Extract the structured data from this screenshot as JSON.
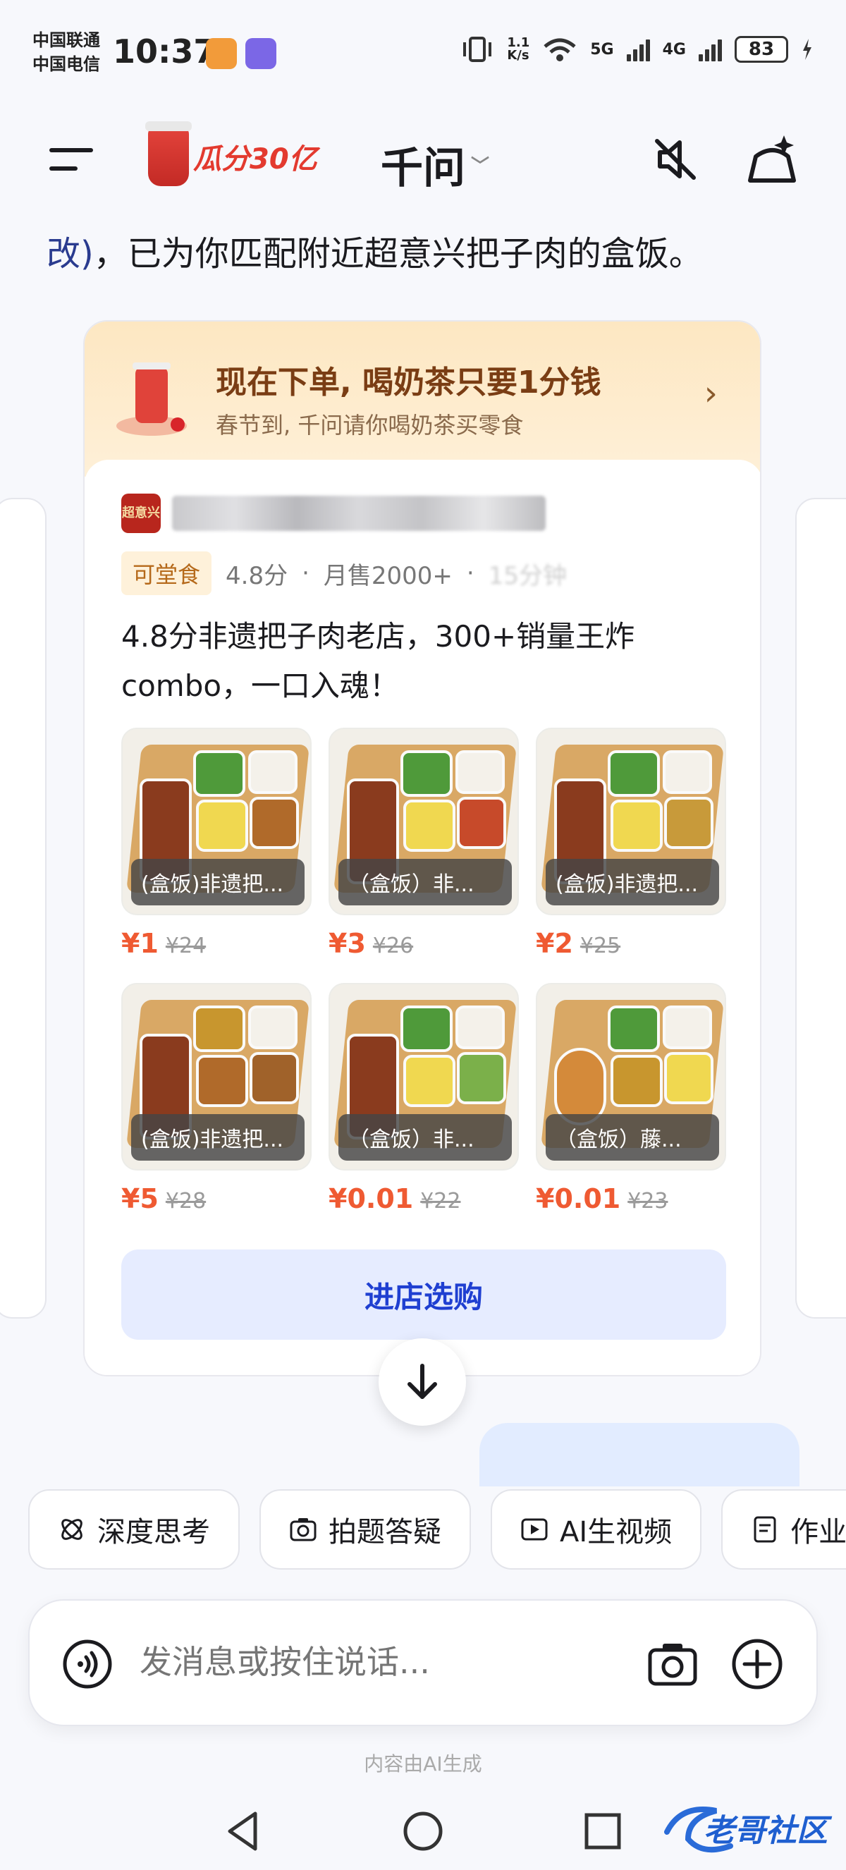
{
  "status_bar": {
    "carrier_1": "中国联通",
    "carrier_2": "中国电信",
    "time": "10:37",
    "speed": "1.1\nK/s",
    "net_1": "5G",
    "net_2": "4G",
    "battery": "83"
  },
  "header": {
    "promo_text": "瓜分30亿",
    "title": "千问",
    "menu_icon": "menu-icon",
    "mute_icon": "speaker-muted-icon",
    "new_chat_icon": "sparkle-compose-icon"
  },
  "intro": {
    "accent": "改)",
    "text": "，已为你匹配附近超意兴把子肉的盒饭。"
  },
  "banner": {
    "title": "现在下单, 喝奶茶只要1分钱",
    "subtitle": "春节到, 千问请你喝奶茶买零食"
  },
  "store": {
    "logo_text": "超意兴",
    "tag": "可堂食",
    "rating": "4.8分",
    "sales": "月售2000+",
    "eta": "15分钟",
    "description": "4.8分非遗把子肉老店，300+销量王炸combo，一口入魂！"
  },
  "dishes": [
    {
      "name": "(盒饭)非遗把...",
      "price": "¥1",
      "original": "¥24"
    },
    {
      "name": "（盒饭）非...",
      "price": "¥3",
      "original": "¥26"
    },
    {
      "name": "(盒饭)非遗把...",
      "price": "¥2",
      "original": "¥25"
    },
    {
      "name": "(盒饭)非遗把...",
      "price": "¥5",
      "original": "¥28"
    },
    {
      "name": "（盒饭）非...",
      "price": "¥0.01",
      "original": "¥22"
    },
    {
      "name": "（盒饭）藤...",
      "price": "¥0.01",
      "original": "¥23"
    }
  ],
  "shop_button": "进店选购",
  "chips": [
    {
      "label": "深度思考",
      "icon": "atom-icon"
    },
    {
      "label": "拍题答疑",
      "icon": "camera-scan-icon"
    },
    {
      "label": "AI生视频",
      "icon": "video-plus-icon"
    },
    {
      "label": "作业",
      "icon": "document-icon"
    }
  ],
  "input": {
    "placeholder": "发消息或按住说话..."
  },
  "footnote": "内容由AI生成",
  "watermark": "老哥社区",
  "colors": {
    "accent_blue": "#1f3fd1",
    "price_red": "#ef5a32",
    "banner_bg": "#fde7c2"
  }
}
